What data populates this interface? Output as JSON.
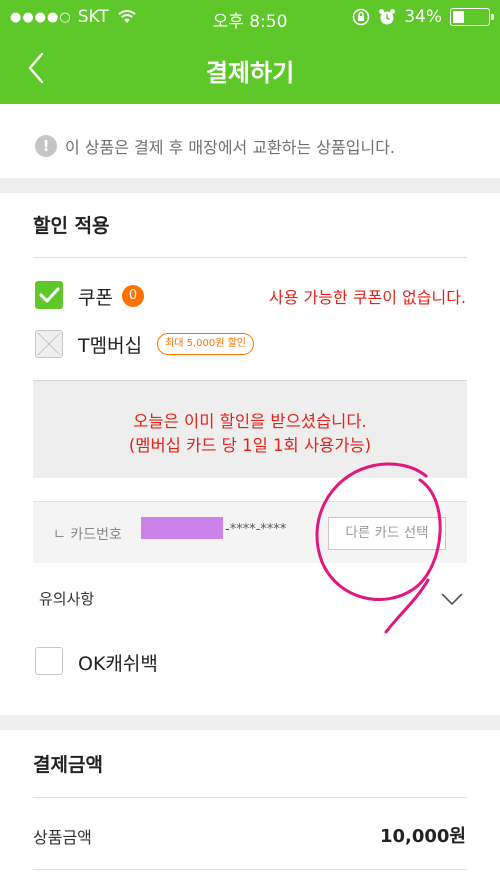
{
  "status_bar": {
    "signal_dots": "●●●●○",
    "carrier": "SKT",
    "time": "오후 8:50",
    "battery": "34%",
    "battery_level": 0.34,
    "icons": [
      "wifi-icon",
      "orientation-lock-icon",
      "alarm-icon",
      "battery-icon"
    ]
  },
  "nav": {
    "title": "결제하기",
    "back_icon": "chevron-left-icon"
  },
  "notice": {
    "icon": "!",
    "text": "이 상품은 결제 후 매장에서 교환하는 상품입니다."
  },
  "discount": {
    "title": "할인 적용",
    "coupon": {
      "label": "쿠폰",
      "count": "0",
      "checked": true,
      "message": "사용 가능한 쿠폰이 없습니다."
    },
    "membership": {
      "label": "T멤버십",
      "badge": "최대 5,000원 할인",
      "notice_line1": "오늘은 이미 할인을 받으셨습니다.",
      "notice_line2": "(멤버십 카드 당 1일 1회 사용가능)",
      "card_label": "ㄴ 카드번호",
      "card_digits": "-****-****",
      "other_card_button": "다른 카드 선택"
    },
    "notes_label": "유의사항",
    "ok_cashbag": {
      "label": "OK캐쉬백",
      "checked": false
    }
  },
  "payment": {
    "title": "결제금액",
    "product_amount_label": "상품금액",
    "product_amount_value": "10,000원"
  },
  "colors": {
    "brand_green": "#5ec729",
    "alert_red": "#e2231a",
    "badge_orange": "#ff7200",
    "annotation_pink": "#e0197d"
  }
}
